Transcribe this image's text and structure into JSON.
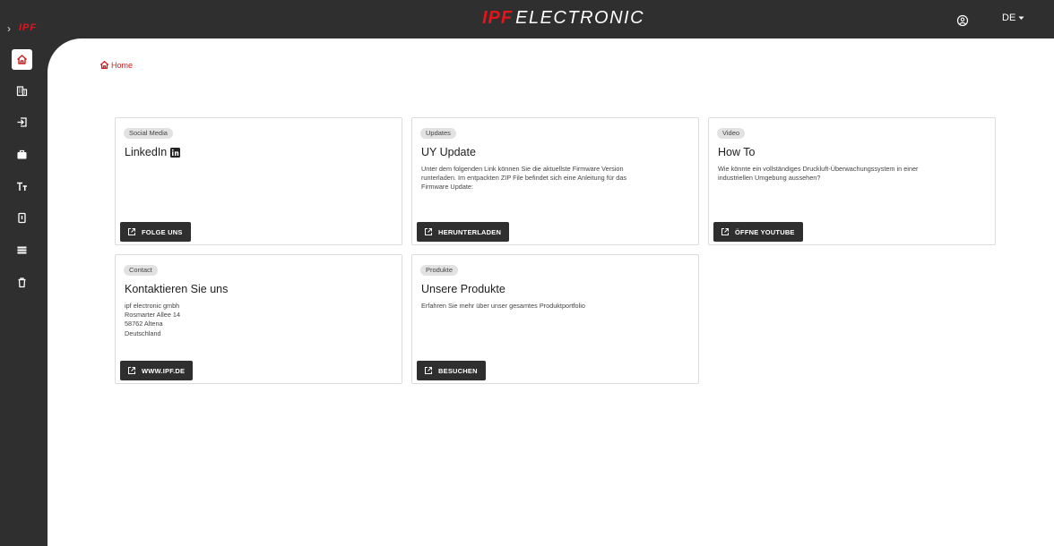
{
  "topbar": {
    "expander": "›",
    "mini_logo": "IPF",
    "brand_bold": "IPF",
    "brand_rest": "ELECTRONIC",
    "language": "DE"
  },
  "sidebar": {
    "items": [
      {
        "icon": "home-icon",
        "active": true
      },
      {
        "icon": "building-icon",
        "active": false
      },
      {
        "icon": "login-icon",
        "active": false
      },
      {
        "icon": "briefcase-icon",
        "active": false
      },
      {
        "icon": "text-size-icon",
        "active": false
      },
      {
        "icon": "device-icon",
        "active": false
      },
      {
        "icon": "list-icon",
        "active": false
      },
      {
        "icon": "trash-icon",
        "active": false
      }
    ]
  },
  "breadcrumb": {
    "home_label": "Home"
  },
  "colors": {
    "accent": "#e3151b",
    "sidebar_bg": "#2f2f2f",
    "button_bg": "#2f2f2f"
  },
  "cards": [
    {
      "chip": "Social Media",
      "title": "LinkedIn",
      "text": "",
      "button": "FOLGE UNS"
    },
    {
      "chip": "Updates",
      "title": "UY Update",
      "text": "Unter dem folgenden Link können Sie die aktuellste Firmware Version\nrunterladen. Im entpackten ZIP File befindet sich eine Anleitung für das\nFirmware Update:",
      "button": "HERUNTERLADEN"
    },
    {
      "chip": "Video",
      "title": "How To",
      "text": "Wie könnte ein vollständiges Druckluft-Überwachungssystem in einer\nindustriellen Umgebung aussehen?",
      "button": "ÖFFNE YOUTUBE"
    },
    {
      "chip": "Contact",
      "title": "Kontaktieren Sie uns",
      "text": "ipf electronic gmbh\n Rosmarter Allee 14\n 58762 Altena\nDeutschland",
      "button": "WWW.IPF.DE"
    },
    {
      "chip": "Produkte",
      "title": "Unsere Produkte",
      "text": "Erfahren Sie mehr über unser gesamtes Produktportfolio",
      "button": "BESUCHEN"
    }
  ]
}
